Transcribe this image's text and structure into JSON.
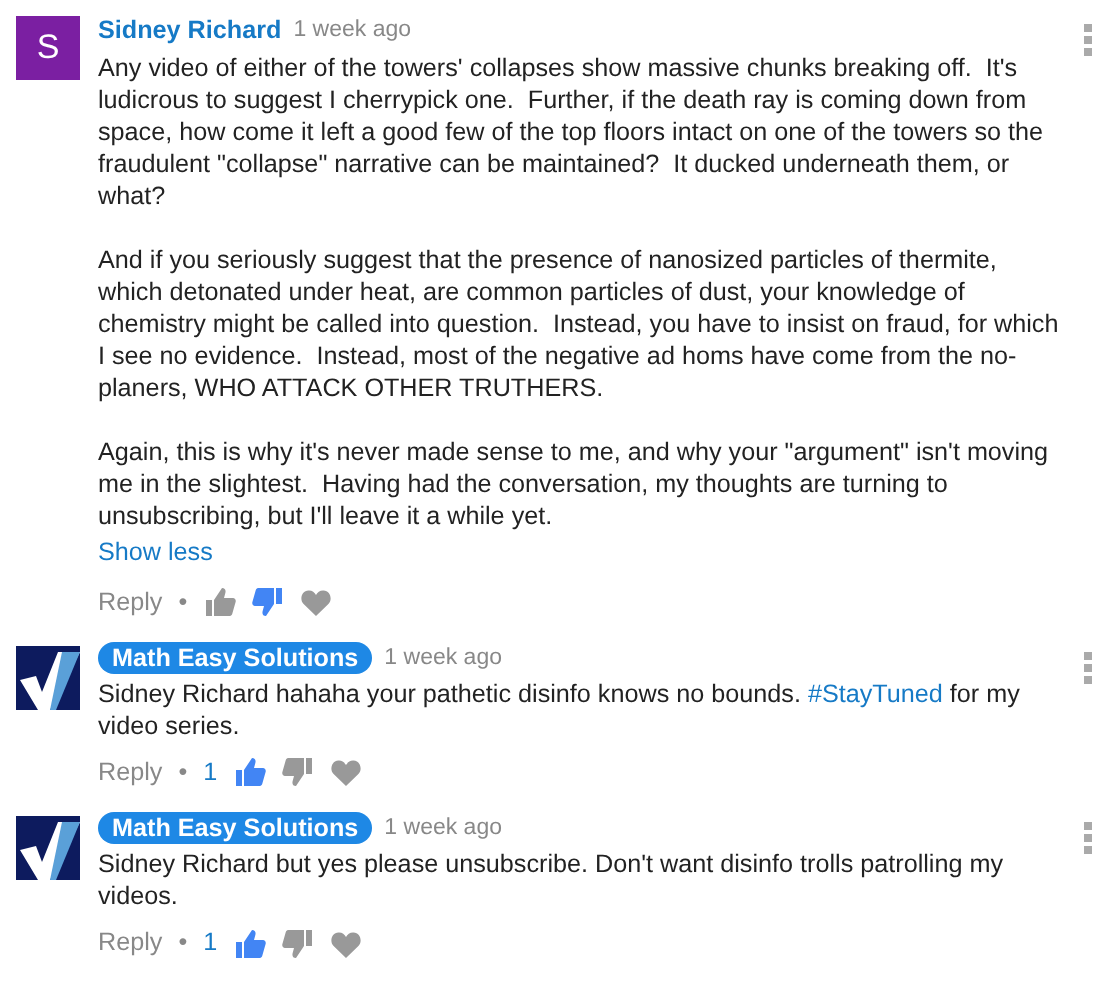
{
  "comments": [
    {
      "avatar": {
        "kind": "letter",
        "letter": "S"
      },
      "author": "Sidney Richard",
      "highlighted": false,
      "time": "1 week ago",
      "paragraphs": [
        [
          {
            "text": "Any video of either of the towers' collapses show massive chunks breaking off.  It's ludicrous to suggest I cherrypick one.  Further, if the death ray is coming down from space, how come it left a good few of the top floors intact on one of the towers so the fraudulent \"collapse\" narrative can be maintained?  It ducked underneath them, or what?"
          }
        ],
        [
          {
            "text": "And if you seriously suggest that the presence of nanosized particles of thermite, which detonated under heat, are common particles of dust, your knowledge of chemistry might be called into question.  Instead, you have to insist on fraud, for which I see no evidence.  Instead, most of the negative ad homs have come from the no-planers, WHO ATTACK OTHER TRUTHERS."
          }
        ],
        [
          {
            "text": "Again, this is why it's never made sense to me, and why your \"argument\" isn't moving me in the slightest.  Having had the conversation, my thoughts are turning to unsubscribing, but I'll leave it a while yet."
          }
        ]
      ],
      "toggle": "Show less",
      "reply": "Reply",
      "separator": "•",
      "liked": false,
      "disliked": true
    },
    {
      "avatar": {
        "kind": "logo"
      },
      "author": "Math Easy Solutions",
      "highlighted": true,
      "time": "1 week ago",
      "paragraphs": [
        [
          {
            "text": "Sidney Richard hahaha your pathetic disinfo knows no bounds. "
          },
          {
            "text": "#StayTuned",
            "kind": "hashtag"
          },
          {
            "text": " for my video series."
          }
        ]
      ],
      "reply": "Reply",
      "separator": "•",
      "likes": "1",
      "liked": true,
      "disliked": false
    },
    {
      "avatar": {
        "kind": "logo"
      },
      "author": "Math Easy Solutions",
      "highlighted": true,
      "time": "1 week ago",
      "paragraphs": [
        [
          {
            "text": "Sidney Richard but yes please unsubscribe. Don't want disinfo trolls patrolling my videos."
          }
        ]
      ],
      "reply": "Reply",
      "separator": "•",
      "likes": "1",
      "liked": true,
      "disliked": false
    }
  ]
}
